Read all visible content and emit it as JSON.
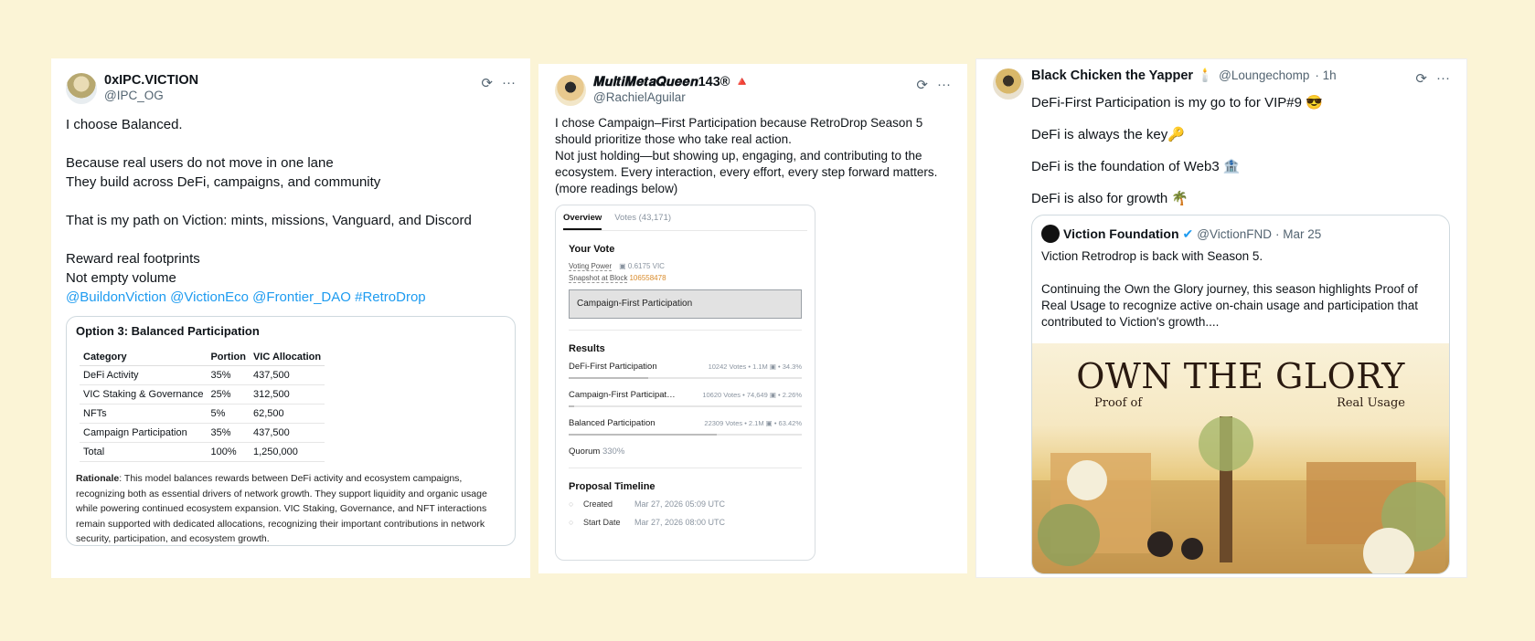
{
  "card1": {
    "display_name": "0xIPC.VICTION",
    "handle": "@IPC_OG",
    "body_lines": "I choose Balanced.\n\nBecause real users do not move in one lane\nThey build across DeFi, campaigns, and community\n\nThat is my path on Viction: mints, missions, Vanguard, and Discord\n\nReward real footprints\nNot empty volume\n",
    "mentions": "@BuildonViction @VictionEco @Frontier_DAO #RetroDrop",
    "option_title": "Option 3: Balanced Participation",
    "table_headers": [
      "Category",
      "Portion",
      "VIC Allocation"
    ],
    "table_rows": [
      [
        "DeFi Activity",
        "35%",
        "437,500"
      ],
      [
        "VIC Staking & Governance",
        "25%",
        "312,500"
      ],
      [
        "NFTs",
        "5%",
        "62,500"
      ],
      [
        "Campaign Participation",
        "35%",
        "437,500"
      ],
      [
        "Total",
        "100%",
        "1,250,000"
      ]
    ],
    "rationale_label": "Rationale",
    "rationale_text": ": This model balances rewards between DeFi activity and ecosystem campaigns, recognizing both as essential drivers of network growth. They support liquidity and organic usage while powering continued ecosystem expansion. VIC Staking, Governance, and NFT interactions remain supported with dedicated allocations, recognizing their important contributions in network security, participation, and ecosystem growth."
  },
  "card2": {
    "display_name": "𝑴𝒖𝒍𝒕𝒊𝑴𝒆𝒕𝒂𝑸𝒖𝒆𝒆𝒏143® 🔺",
    "handle": "@RachielAguilar",
    "body": "I chose Campaign–First Participation because RetroDrop Season 5 should prioritize those who take real action.\nNot just holding—but showing up, engaging, and contributing to the ecosystem. Every interaction, every effort, every step forward matters.\n(more readings below)",
    "tabs": [
      "Overview",
      "Votes (43,171)"
    ],
    "your_vote_title": "Your Vote",
    "voting_power_label": "Voting Power",
    "voting_power_value": "0.6175 VIC",
    "snapshot_label": "Snapshot at Block",
    "snapshot_value": "106558478",
    "selected_option": "Campaign-First Participation",
    "results_title": "Results",
    "results": [
      {
        "label": "DeFi-First Participation",
        "stats": "10242 Votes • 1.1M ▣ • 34.3%",
        "percent": 34.3
      },
      {
        "label": "Campaign-First Participation",
        "stats": "10620 Votes • 74,649 ▣ • 2.26%",
        "percent": 2.26
      },
      {
        "label": "Balanced Participation",
        "stats": "22309 Votes • 2.1M ▣ • 63.42%",
        "percent": 63.42
      }
    ],
    "quorum_label": "Quorum",
    "quorum_value": "330%",
    "timeline_title": "Proposal Timeline",
    "timeline": [
      {
        "label": "Created",
        "date": "Mar 27, 2026  05:09 UTC"
      },
      {
        "label": "Start Date",
        "date": "Mar 27, 2026  08:00 UTC"
      }
    ]
  },
  "card3": {
    "display_name": "Black Chicken the Yapper 🕯️",
    "handle": "@Loungechomp",
    "time": "· 1h",
    "body": "DeFi-First Participation is my go to for VIP#9 😎\nDeFi is always the key🔑\nDeFi is the foundation of Web3 🏦\nDeFi is also for growth 🌴",
    "quote_name": "Viction Foundation",
    "quote_handle": "@VictionFND",
    "quote_time": "· Mar 25",
    "quote_body": "Viction Retrodrop is back with Season 5.\n\nContinuing the Own the Glory journey, this season highlights Proof of Real Usage to recognize active on-chain usage and participation that contributed to Viction's growth....",
    "poster_title": "OWN THE GLORY",
    "poster_sub_left": "Proof of",
    "poster_sub_right": "Real Usage"
  },
  "icons": {
    "grok": "⟳",
    "more": "···",
    "verified": "✔"
  },
  "colors": {
    "background": "#fbf4d6",
    "link": "#1d9bf0",
    "text": "#0f1419",
    "muted": "#536471"
  }
}
